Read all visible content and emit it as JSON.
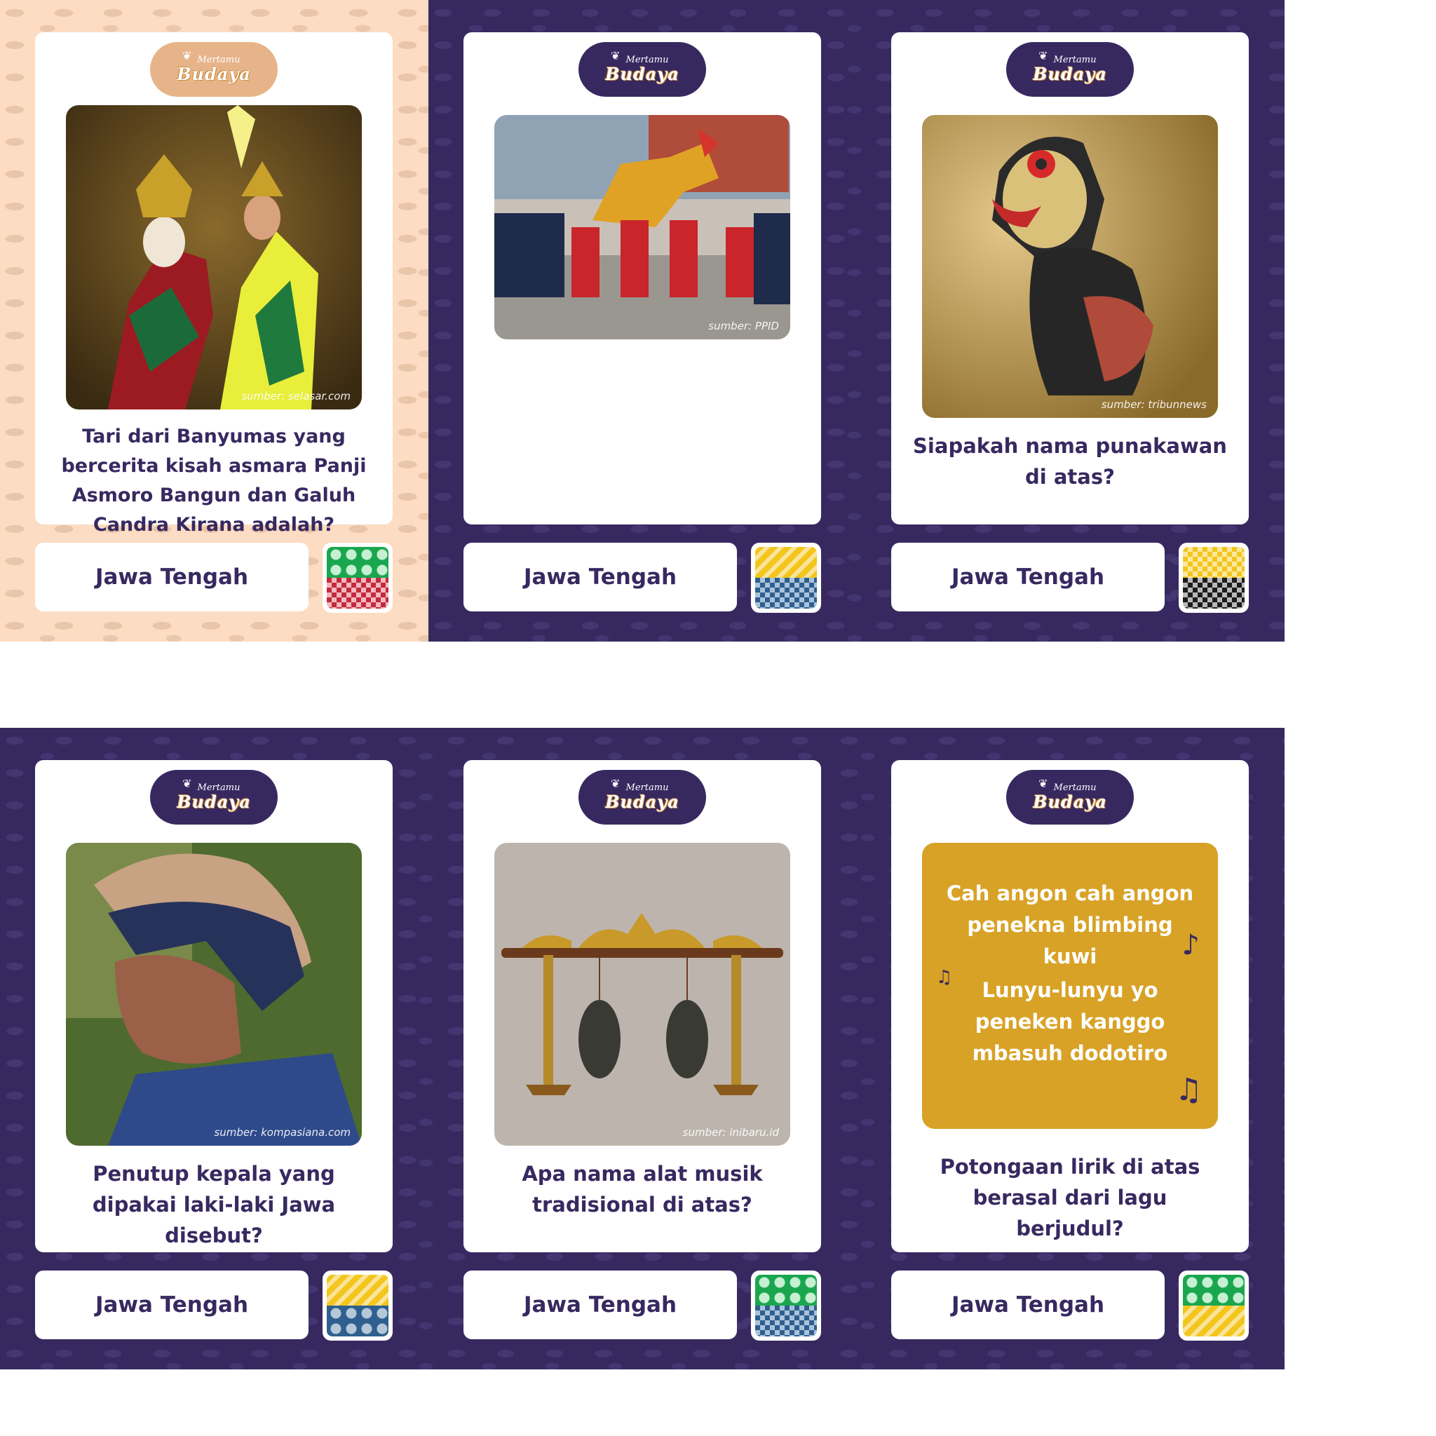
{
  "logo": {
    "line1": "Mertamu",
    "line2": "Budaya"
  },
  "cards": [
    {
      "question": "Tari dari Banyumas yang bercerita kisah asmara Panji Asmoro Bangun dan Galuh Candra Kirana adalah?",
      "credit": "sumber: selasar.com",
      "region": "Jawa Tengah"
    },
    {
      "question": "",
      "credit": "sumber: PPID",
      "region": "Jawa Tengah"
    },
    {
      "question": "Siapakah nama punakawan di atas?",
      "credit": "sumber: tribunnews",
      "region": "Jawa Tengah"
    },
    {
      "question": "Penutup kepala yang dipakai laki-laki Jawa disebut?",
      "credit": "sumber: kompasiana.com",
      "region": "Jawa Tengah"
    },
    {
      "question": "Apa nama alat musik tradisional di atas?",
      "credit": "sumber: inibaru.id",
      "region": "Jawa Tengah"
    },
    {
      "question": "Potongaan lirik di atas berasal dari lagu berjudul?",
      "region": "Jawa Tengah",
      "lyrics": {
        "line1": "Cah angon cah angon penekna blimbing kuwi",
        "line2": "Lunyu-lunyu yo peneken kanggo mbasuh dodotiro"
      }
    }
  ],
  "colors": {
    "purple": "#372960",
    "peach": "#fcdcc2",
    "gold": "#d8a226"
  },
  "icons": [
    "music-note-icon",
    "beamed-notes-icon"
  ]
}
